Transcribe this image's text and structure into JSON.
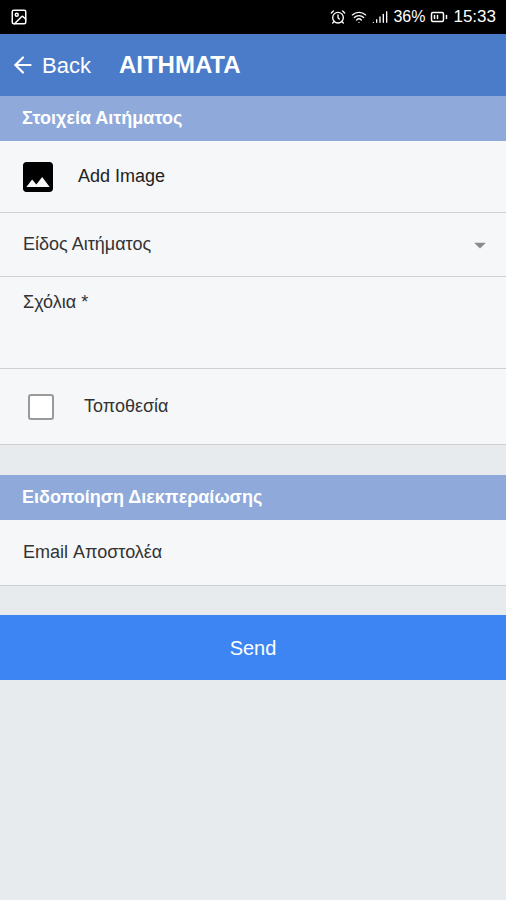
{
  "status_bar": {
    "battery": "36%",
    "time": "15:33"
  },
  "header": {
    "back": "Back",
    "title": "ΑΙΤΗΜΑΤΑ"
  },
  "sections": [
    {
      "title": "Στοιχεία Αιτήματος",
      "fields": [
        {
          "kind": "image",
          "label": "Add Image"
        },
        {
          "kind": "select",
          "label": "Είδος Αιτήματος"
        },
        {
          "kind": "textarea",
          "label": "Σχόλια *"
        },
        {
          "kind": "checkbox",
          "label": "Τοποθεσία",
          "checked": false
        }
      ]
    },
    {
      "title": "Ειδοποίηση Διεκπεραίωσης",
      "fields": [
        {
          "kind": "text",
          "label": "Email Αποστολέα"
        }
      ]
    }
  ],
  "submit": "Send"
}
